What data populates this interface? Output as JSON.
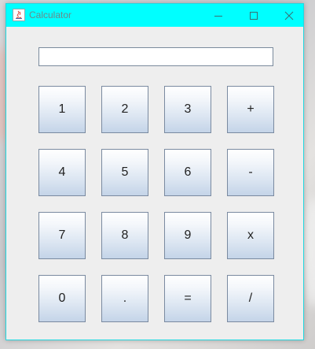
{
  "window": {
    "title": "Calculator",
    "controls": {
      "minimize_icon": "minimize-icon",
      "maximize_icon": "maximize-icon",
      "close_icon": "close-icon"
    },
    "titlebar_color": "#00ffff"
  },
  "display": {
    "value": ""
  },
  "keys": {
    "row1": [
      "1",
      "2",
      "3",
      "+"
    ],
    "row2": [
      "4",
      "5",
      "6",
      "-"
    ],
    "row3": [
      "7",
      "8",
      "9",
      "x"
    ],
    "row4": [
      "0",
      ".",
      "=",
      "/"
    ]
  }
}
